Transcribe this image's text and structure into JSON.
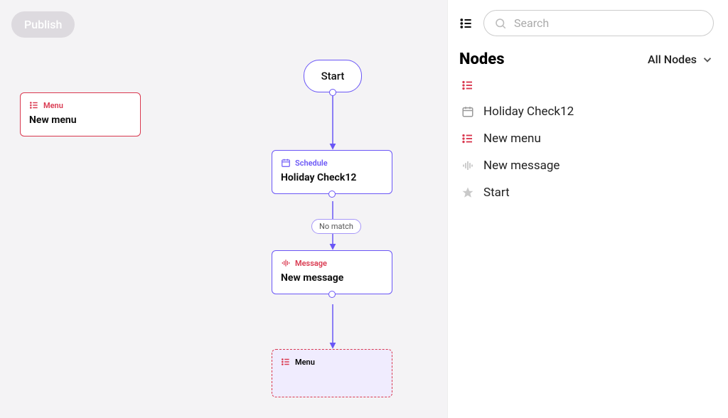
{
  "toolbar": {
    "publish_label": "Publish"
  },
  "flow": {
    "start_label": "Start",
    "no_match_badge": "No match",
    "nodes": {
      "menu": {
        "type_label": "Menu",
        "title": "New menu"
      },
      "schedule": {
        "type_label": "Schedule",
        "title": "Holiday Check12"
      },
      "message": {
        "type_label": "Message",
        "title": "New message"
      },
      "menu2": {
        "type_label": "Menu",
        "title": ""
      }
    }
  },
  "panel": {
    "search_placeholder": "Search",
    "heading": "Nodes",
    "filter_label": "All Nodes",
    "items": [
      {
        "label": ""
      },
      {
        "label": "Holiday Check12"
      },
      {
        "label": "New menu"
      },
      {
        "label": "New message"
      },
      {
        "label": "Start"
      }
    ]
  }
}
